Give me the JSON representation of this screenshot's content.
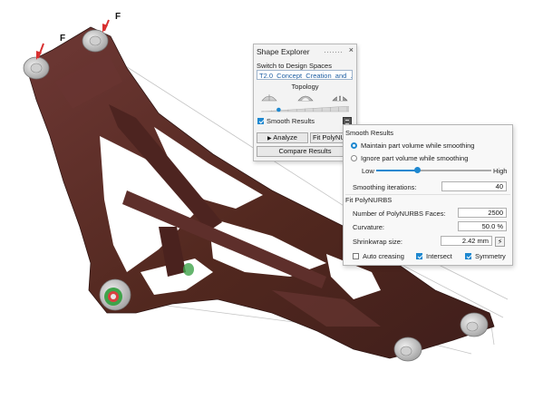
{
  "viewport": {
    "force_label_1": "F",
    "force_label_2": "F"
  },
  "shape_explorer": {
    "title": "Shape Explorer",
    "switch_label": "Switch to Design Spaces",
    "design_space_value": "T2.0_Concept_Creation_and_...",
    "topology_label": "Topology",
    "smooth_results_label": "Smooth Results",
    "smooth_results_checked": true,
    "analyze_label": "Analyze",
    "fit_polynurbs_label": "Fit PolyNURBS",
    "compare_results_label": "Compare Results",
    "topology_level": 0.2
  },
  "smooth_popup": {
    "header": "Smooth Results",
    "option_maintain": "Maintain part volume while smoothing",
    "option_ignore": "Ignore part volume while smoothing",
    "selected_option": "maintain",
    "slider_low": "Low",
    "slider_high": "High",
    "slider_level": 0.36,
    "iterations_label": "Smoothing iterations:",
    "iterations_value": "40",
    "fit_header": "Fit PolyNURBS",
    "faces_label": "Number of PolyNURBS Faces:",
    "faces_value": "2500",
    "curvature_label": "Curvature:",
    "curvature_value": "50.0 %",
    "shrinkwrap_label": "Shrinkwrap size:",
    "shrinkwrap_value": "2.42 mm",
    "auto_creasing_label": "Auto creasing",
    "auto_creasing_checked": false,
    "intersect_label": "Intersect",
    "intersect_checked": true,
    "symmetry_label": "Symmetry",
    "symmetry_checked": true
  },
  "colors": {
    "part": "#5a2c2a",
    "accent": "#1e88d0"
  }
}
